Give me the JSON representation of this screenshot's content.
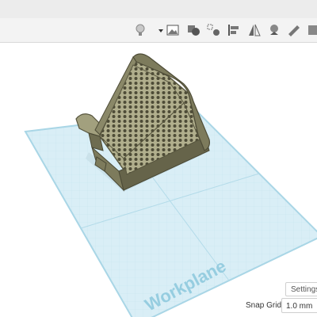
{
  "toolbar": {
    "icons": [
      {
        "name": "lightbulb-icon"
      },
      {
        "name": "dropdown-caret-icon"
      },
      {
        "name": "import-image-icon"
      },
      {
        "name": "group-shapes-icon"
      },
      {
        "name": "ungroup-shapes-icon"
      },
      {
        "name": "align-icon"
      },
      {
        "name": "mirror-icon"
      },
      {
        "name": "cruise-icon"
      },
      {
        "name": "ruler-icon"
      },
      {
        "name": "notes-icon"
      }
    ]
  },
  "workplane": {
    "label": "Workplane",
    "colors": {
      "plane": "#d9eef6",
      "grid": "#b9dcea",
      "edge": "#9fd0e0",
      "label": "#8fc8dc"
    }
  },
  "model": {
    "name": "honeycomb-phone-stand",
    "colors": {
      "body": "#7d7b5c",
      "body_light": "#a2a07e",
      "body_dark": "#57553e",
      "shadow": "#3f3e2c"
    }
  },
  "footer": {
    "settings_label": "Settings",
    "snap_grid_label": "Snap Grid",
    "snap_grid_value": "1.0 mm"
  }
}
